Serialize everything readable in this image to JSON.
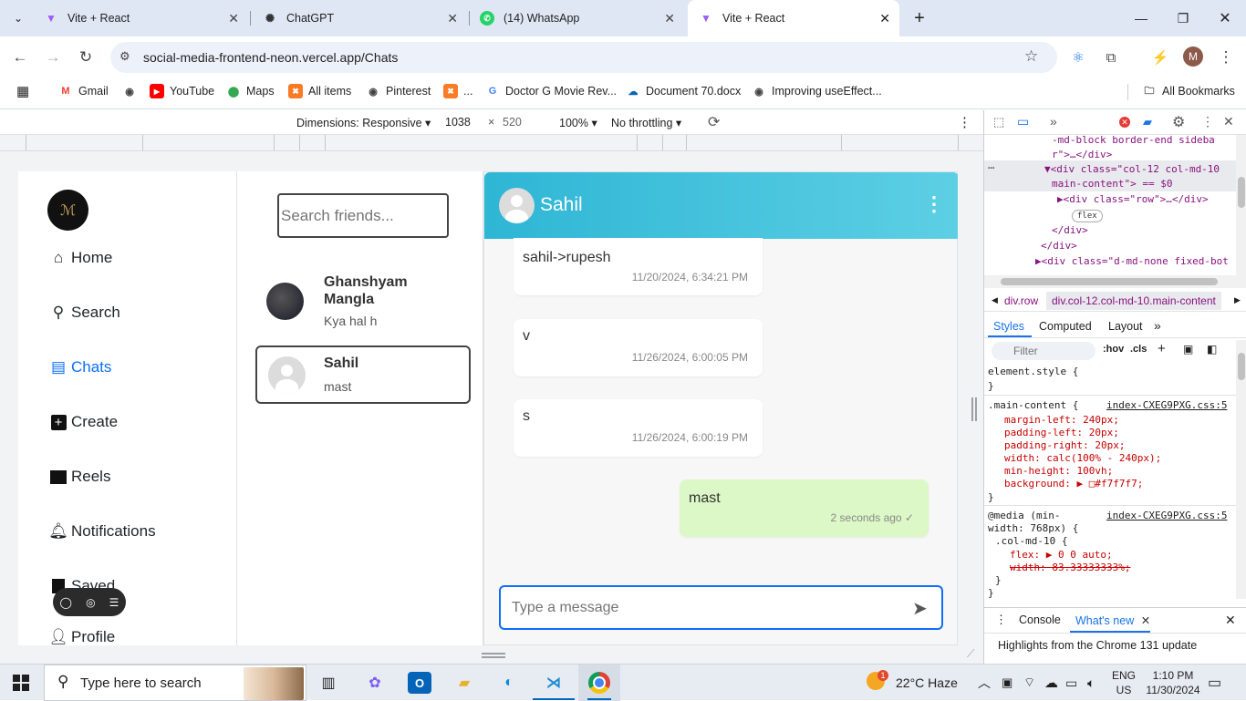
{
  "browser": {
    "tabs": [
      {
        "title": "Vite + React",
        "icon": "vite-icon",
        "active": false
      },
      {
        "title": "ChatGPT",
        "icon": "chatgpt-icon",
        "active": false
      },
      {
        "title": "(14) WhatsApp",
        "icon": "whatsapp-icon",
        "active": false
      },
      {
        "title": "Vite + React",
        "icon": "vite-icon",
        "active": true
      }
    ],
    "new_tab": "+",
    "url": "social-media-frontend-neon.vercel.app/Chats",
    "bookmarks": [
      {
        "label": "Gmail",
        "icon": "gmail-icon",
        "color": "#ea4335"
      },
      {
        "label": "",
        "icon": "globe-icon",
        "color": "#444444"
      },
      {
        "label": "YouTube",
        "icon": "youtube-icon",
        "color": "#ff0000"
      },
      {
        "label": "Maps",
        "icon": "maps-icon",
        "color": "#34a853"
      },
      {
        "label": "All items",
        "icon": "xampp-icon",
        "color": "#fb7a24"
      },
      {
        "label": "Pinterest",
        "icon": "globe-icon",
        "color": "#444444"
      },
      {
        "label": "...",
        "icon": "xampp-icon",
        "color": "#fb7a24"
      },
      {
        "label": "Doctor G Movie Rev...",
        "icon": "google-icon",
        "color": "#4285f4"
      },
      {
        "label": "Document 70.docx",
        "icon": "onedrive-icon",
        "color": "#0364b8"
      },
      {
        "label": "Improving useEffect...",
        "icon": "globe-icon",
        "color": "#444444"
      }
    ],
    "all_bookmarks": "All Bookmarks"
  },
  "device_toolbar": {
    "dimensions_label": "Dimensions: Responsive",
    "width": "1038",
    "height": "520",
    "times": "×",
    "zoom": "100%",
    "throttling": "No throttling"
  },
  "app": {
    "nav": [
      {
        "label": "Home",
        "icon": "home-icon",
        "active": false
      },
      {
        "label": "Search",
        "icon": "search-icon",
        "active": false
      },
      {
        "label": "Chats",
        "icon": "chat-icon",
        "active": true
      },
      {
        "label": "Create",
        "icon": "plus-square-icon",
        "active": false
      },
      {
        "label": "Reels",
        "icon": "film-icon",
        "active": false
      },
      {
        "label": "Notifications",
        "icon": "bell-icon",
        "active": false
      },
      {
        "label": "Saved",
        "icon": "bookmark-icon",
        "active": false
      },
      {
        "label": "Profile",
        "icon": "person-icon",
        "active": false
      }
    ],
    "search_placeholder": "Search friends...",
    "friends": [
      {
        "name": "Ghanshyam Mangla",
        "last": "Kya hal h",
        "selected": false
      },
      {
        "name": "Sahil",
        "last": "mast",
        "selected": true
      }
    ],
    "chat": {
      "contact": "Sahil",
      "messages": [
        {
          "text": "sahil->rupesh",
          "time": "11/20/2024, 6:34:21 PM",
          "mine": false
        },
        {
          "text": "v",
          "time": "11/26/2024, 6:00:05 PM",
          "mine": false
        },
        {
          "text": "s",
          "time": "11/26/2024, 6:00:19 PM",
          "mine": false
        },
        {
          "text": "mast",
          "time": "2 seconds ago",
          "mine": true,
          "tick": "✓"
        }
      ],
      "input_placeholder": "Type a message"
    },
    "accent_color": "#0d6efd",
    "header_color": "#2eb6d5"
  },
  "devtools": {
    "elements": [
      {
        "text": "-md-block border-end sideba",
        "indent": 6
      },
      {
        "text": "r\">…</div>",
        "indent": 6
      },
      {
        "text": "▼<div class=\"col-12 col-md-10",
        "indent": 5
      },
      {
        "text": "main-content\"> == $0",
        "indent": 6
      },
      {
        "text": "▶<div class=\"row\">…</div>",
        "indent": 7
      },
      {
        "text": "flex",
        "indent": 8
      },
      {
        "text": "</div>",
        "indent": 6
      },
      {
        "text": "</div>",
        "indent": 5
      },
      {
        "text": "▶<div class=\"d-md-none fixed-bot",
        "indent": 4
      }
    ],
    "breadcrumb": [
      "div.row",
      "div.col-12.col-md-10.main-content"
    ],
    "tabs": [
      "Styles",
      "Computed",
      "Layout",
      "»"
    ],
    "filter_placeholder": "Filter",
    "hov": ":hov",
    "cls": ".cls",
    "rules": [
      {
        "line": "element.style {",
        "source": ""
      },
      {
        "line": "}",
        "source": ""
      },
      {
        "line": ".main-content {",
        "source": "index-CXEG9PXG.css:5"
      },
      {
        "line": "margin-left: 240px;",
        "source": ""
      },
      {
        "line": "padding-left: 20px;",
        "source": ""
      },
      {
        "line": "padding-right: 20px;",
        "source": ""
      },
      {
        "line": "width: calc(100% - 240px);",
        "source": ""
      },
      {
        "line": "min-height: 100vh;",
        "source": ""
      },
      {
        "line": "background: ▶ □#f7f7f7;",
        "source": ""
      },
      {
        "line": "}",
        "source": ""
      },
      {
        "line": "@media (min-",
        "source": "index-CXEG9PXG.css:5"
      },
      {
        "line": "width: 768px) {",
        "source": ""
      },
      {
        "line": ".col-md-10 {",
        "source": ""
      },
      {
        "line": "flex: ▶ 0 0 auto;",
        "source": ""
      },
      {
        "line": "width: 83.33333333%;",
        "source": ""
      },
      {
        "line": "}",
        "source": ""
      },
      {
        "line": "}",
        "source": ""
      }
    ],
    "drawer_tabs": [
      "Console",
      "What's new"
    ],
    "drawer_text": "Highlights from the Chrome 131 update"
  },
  "taskbar": {
    "search_placeholder": "Type here to search",
    "weather": "22°C  Haze",
    "lang1": "ENG",
    "lang2": "US",
    "time": "1:10 PM",
    "date": "11/30/2024",
    "badge": "1"
  }
}
